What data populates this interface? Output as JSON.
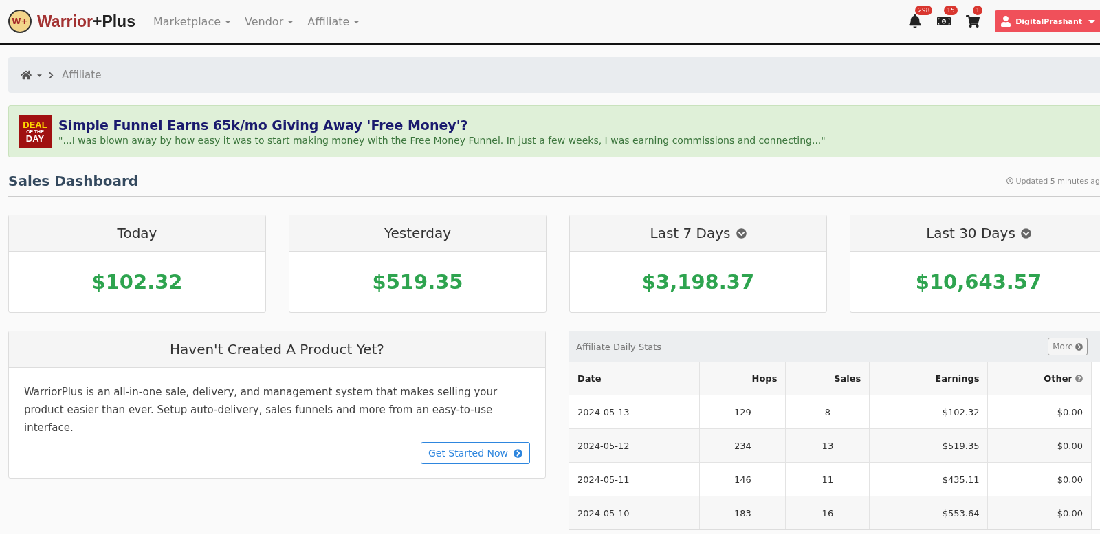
{
  "navbar": {
    "logo_mark": "W+",
    "brand_first": "Warrior",
    "brand_second": "+Plus",
    "menus": [
      {
        "label": "Marketplace"
      },
      {
        "label": "Vendor"
      },
      {
        "label": "Affiliate"
      }
    ],
    "icons": [
      {
        "kind": "bell",
        "count": "298"
      },
      {
        "kind": "money",
        "count": "15"
      },
      {
        "kind": "cart",
        "count": "1"
      }
    ],
    "user": "DigitalPrashant"
  },
  "breadcrumb": {
    "current": "Affiliate"
  },
  "deal": {
    "badge": [
      "DEAL",
      "OF THE",
      "DAY"
    ],
    "title": "Simple Funnel Earns 65k/mo Giving Away 'Free Money'?",
    "quote": "\"...I was blown away by how easy it was to start making money with the Free Money Funnel. In just a few weeks, I was earning commissions and connecting...\""
  },
  "dashboard": {
    "title": "Sales Dashboard",
    "updated": "Updated 5 minutes ag"
  },
  "stats": [
    {
      "label": "Today",
      "value": "$102.32",
      "dropdown": false
    },
    {
      "label": "Yesterday",
      "value": "$519.35",
      "dropdown": false
    },
    {
      "label": "Last 7 Days",
      "value": "$3,198.37",
      "dropdown": true
    },
    {
      "label": "Last 30 Days",
      "value": "$10,643.57",
      "dropdown": true
    }
  ],
  "promo": {
    "title": "Haven't Created A Product Yet?",
    "text": "WarriorPlus is an all-in-one sale, delivery, and management system that makes selling your product easier than ever. Setup auto-delivery, sales funnels and more from an easy-to-use interface.",
    "button": "Get Started Now"
  },
  "daily": {
    "title": "Affiliate Daily Stats",
    "more": "More",
    "columns": [
      "Date",
      "Hops",
      "Sales",
      "Earnings",
      "Other"
    ],
    "rows": [
      [
        "2024-05-13",
        "129",
        "8",
        "$102.32",
        "$0.00"
      ],
      [
        "2024-05-12",
        "234",
        "13",
        "$519.35",
        "$0.00"
      ],
      [
        "2024-05-11",
        "146",
        "11",
        "$435.11",
        "$0.00"
      ],
      [
        "2024-05-10",
        "183",
        "16",
        "$553.64",
        "$0.00"
      ]
    ]
  }
}
